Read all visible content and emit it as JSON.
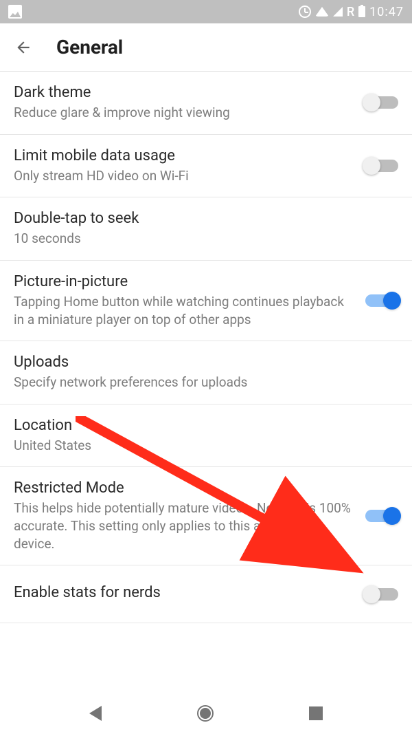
{
  "status_bar": {
    "network_label": "R",
    "time": "10:47"
  },
  "header": {
    "title": "General"
  },
  "settings": [
    {
      "title": "Dark theme",
      "subtitle": "Reduce glare & improve night viewing",
      "toggle": "off"
    },
    {
      "title": "Limit mobile data usage",
      "subtitle": "Only stream HD video on Wi-Fi",
      "toggle": "off"
    },
    {
      "title": "Double-tap to seek",
      "subtitle": "10 seconds",
      "toggle": null
    },
    {
      "title": "Picture-in-picture",
      "subtitle": "Tapping Home button while watching continues playback in a miniature player on top of other apps",
      "toggle": "on"
    },
    {
      "title": "Uploads",
      "subtitle": "Specify network preferences for uploads",
      "toggle": null
    },
    {
      "title": "Location",
      "subtitle": "United States",
      "toggle": null
    },
    {
      "title": "Restricted Mode",
      "subtitle": "This helps hide potentially mature videos. No filter is 100% accurate. This setting only applies to this app on this device.",
      "toggle": "on"
    },
    {
      "title": "Enable stats for nerds",
      "subtitle": "",
      "toggle": "off"
    }
  ]
}
